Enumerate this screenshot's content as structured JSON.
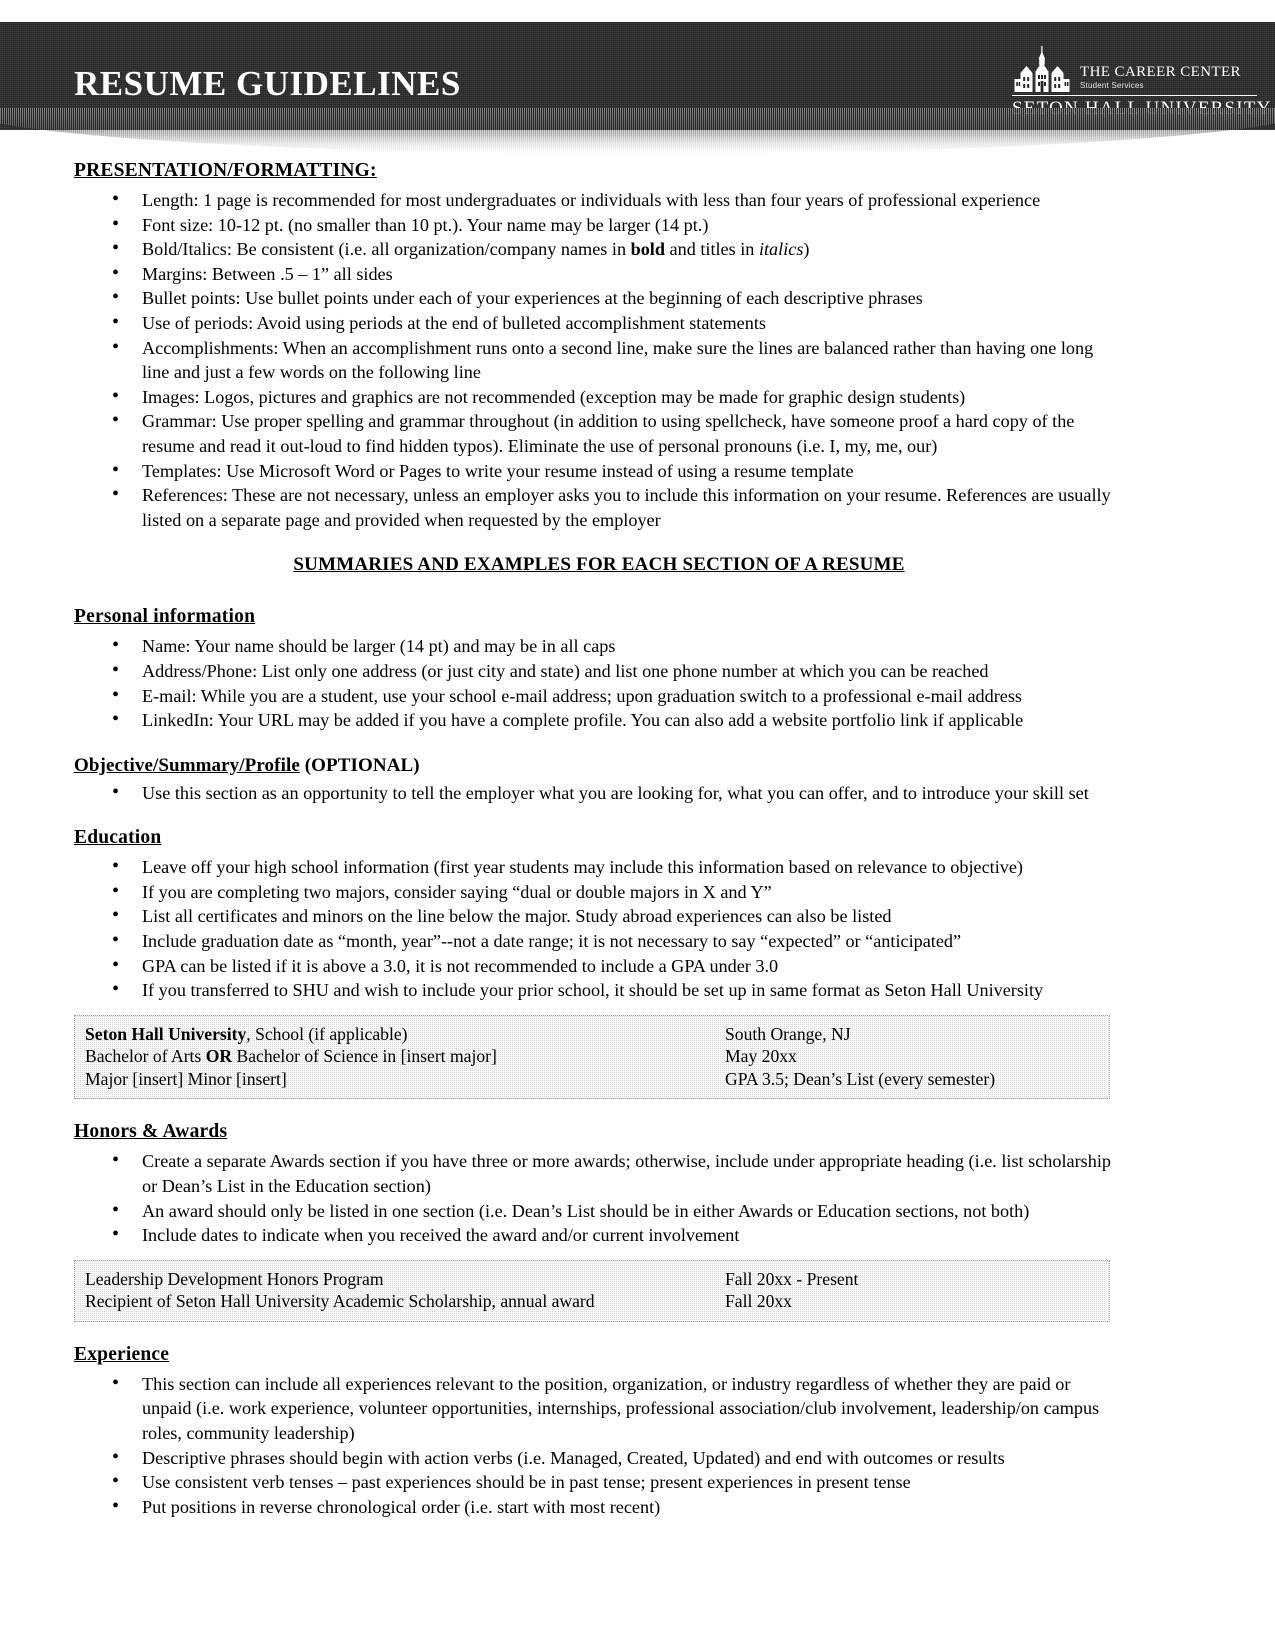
{
  "header": {
    "title": "RESUME GUIDELINES",
    "logo": {
      "mark_name": "seton-hall-building-icon",
      "career_center": "THE CAREER CENTER",
      "subtitle": "Student Services",
      "university": "SETON HALL UNIVERSITY"
    },
    "colors": {
      "banner_bg": "#262626",
      "banner_text": "#ffffff"
    }
  },
  "presentation": {
    "heading": "PRESENTATION/FORMATTING:",
    "bullets": [
      "Length: 1 page is recommended for most undergraduates or individuals with less than four years of professional experience",
      "Font size: 10-12 pt. (no smaller than 10 pt.). Your name may be larger (14 pt.)",
      "Margins: Between .5 – 1” all sides",
      "Bullet points: Use bullet points under each of your experiences at the beginning of each descriptive phrases",
      "Use of periods: Avoid using periods at the end of bulleted accomplishment statements",
      "Accomplishments: When an accomplishment runs onto a second line, make sure the lines are balanced rather than having one long line and just a few words on the following line",
      "Images: Logos, pictures and graphics are not recommended (exception may be made for graphic design students)",
      "Grammar: Use proper spelling and grammar throughout (in addition to using spellcheck, have someone proof a hard copy of the resume and read it out-loud to find hidden typos). Eliminate the use of personal pronouns (i.e. I, my, me, our)",
      "Templates: Use Microsoft Word or Pages to write your resume instead of using a resume template",
      "References: These are not necessary, unless an employer asks you to include this information on your resume. References are usually listed on a separate page and provided when requested by the employer"
    ],
    "bold_italics_bullet": {
      "lead": "Bold/Italics: Be consistent (i.e. all organization/company names in ",
      "bold_word": "bold",
      "mid": " and titles in ",
      "italic_word": "italics",
      "tail": ")"
    }
  },
  "summaries_heading": "SUMMARIES AND EXAMPLES FOR EACH SECTION OF A RESUME",
  "personal_information": {
    "heading": "Personal information",
    "bullets": [
      "Name: Your name should be larger (14 pt) and may be in all caps",
      "Address/Phone: List only one address (or just city and state) and list one phone number at which you can be reached",
      "E-mail: While you are a student, use your school e-mail address; upon graduation switch to a professional e-mail address",
      "LinkedIn: Your URL may be added if you have a complete profile. You can also add a website portfolio link if applicable"
    ]
  },
  "objective": {
    "heading_underlined": "Objective/Summary/Profile",
    "heading_suffix": " (OPTIONAL)",
    "bullets": [
      "Use this section as an opportunity to tell the employer what you are looking for, what you can offer, and to introduce your skill set"
    ]
  },
  "education": {
    "heading": "Education",
    "bullets": [
      "Leave off your high school information (first year students may include this information based on relevance to objective)",
      "If you are completing two majors, consider saying “dual or double majors in X and Y”",
      "List all certificates and minors on the line below the major. Study abroad experiences can also be listed",
      "Include graduation date as “month, year”--not a date range; it is not necessary to say “expected” or “anticipated”",
      "GPA can be listed if it is above a 3.0, it is not recommended to include a GPA under 3.0",
      "If you transferred to SHU and wish to include your prior school, it should be set up in same format as Seton Hall University"
    ],
    "example": [
      {
        "left_bold": "Seton Hall University",
        "left_rest": ", School (if applicable)",
        "right": "South Orange, NJ"
      },
      {
        "left_pre": "Bachelor of Arts ",
        "left_bold": "OR",
        "left_rest": " Bachelor of Science in [insert major]",
        "right": "May 20xx"
      },
      {
        "left_rest": "Major [insert] Minor [insert]",
        "right": "GPA 3.5; Dean’s List (every semester)"
      }
    ]
  },
  "honors": {
    "heading": "Honors & Awards",
    "bullets": [
      "Create a separate Awards section if you have three or more awards; otherwise, include under appropriate heading (i.e. list scholarship or Dean’s List in the Education section)",
      "An award should only be listed in one section (i.e. Dean’s List should be in either Awards or Education sections, not both)",
      "Include dates to indicate when you received the award and/or current involvement"
    ],
    "example": [
      {
        "left_rest": "Leadership Development Honors Program",
        "right": "Fall 20xx - Present"
      },
      {
        "left_rest": "Recipient of Seton Hall University Academic Scholarship, annual award",
        "right": "Fall 20xx"
      }
    ]
  },
  "experience": {
    "heading": "Experience",
    "bullets": [
      "This section can include all experiences relevant to the position, organization, or industry regardless of whether they are paid or unpaid (i.e. work experience, volunteer opportunities, internships, professional association/club involvement, leadership/on campus roles, community leadership)",
      "Descriptive phrases should begin with action verbs (i.e. Managed, Created, Updated) and end with outcomes or results",
      "Use consistent verb tenses – past experiences should be in past tense; present experiences in present tense",
      "Put positions in reverse chronological order (i.e. start with most recent)"
    ]
  }
}
